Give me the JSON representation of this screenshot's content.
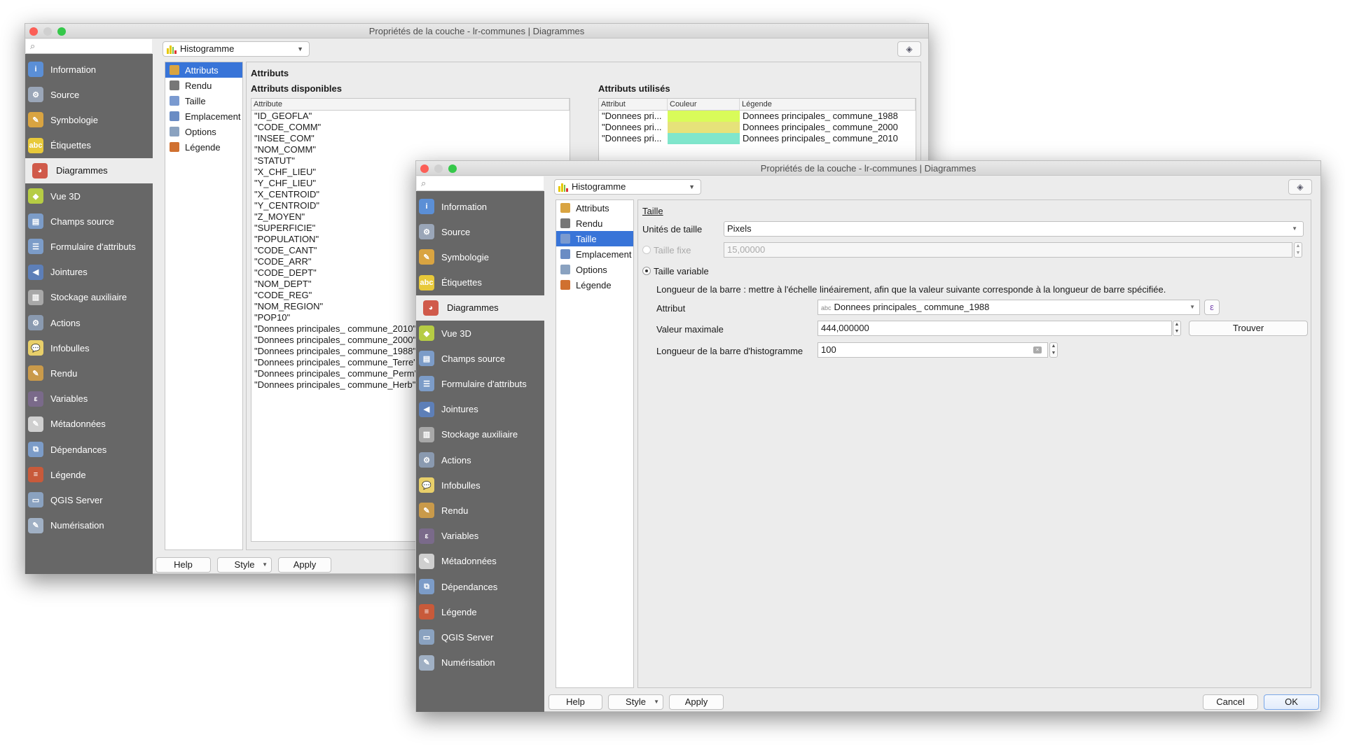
{
  "sidebar_items": [
    {
      "label": "Information",
      "icon": "information-icon",
      "color": "#5b8fd6",
      "glyph": "i"
    },
    {
      "label": "Source",
      "icon": "source-gear-icon",
      "color": "#9aa6b8",
      "glyph": "⚙"
    },
    {
      "label": "Symbologie",
      "icon": "symbology-brush-icon",
      "color": "#d9a441",
      "glyph": "✎"
    },
    {
      "label": "Étiquettes",
      "icon": "labels-abc-icon",
      "color": "#e8c93a",
      "glyph": "abc"
    },
    {
      "label": "Diagrammes",
      "icon": "diagrams-icon",
      "color": "#d05a4a",
      "glyph": "◕"
    },
    {
      "label": "Vue 3D",
      "icon": "3d-cube-icon",
      "color": "#b6cc44",
      "glyph": "◆"
    },
    {
      "label": "Champs source",
      "icon": "source-fields-icon",
      "color": "#7c9cc8",
      "glyph": "▤"
    },
    {
      "label": "Formulaire d'attributs",
      "icon": "attribute-form-icon",
      "color": "#7c9cc8",
      "glyph": "☰"
    },
    {
      "label": "Jointures",
      "icon": "joins-icon",
      "color": "#5d7fb8",
      "glyph": "◀"
    },
    {
      "label": "Stockage auxiliaire",
      "icon": "auxiliary-storage-icon",
      "color": "#a8a8a8",
      "glyph": "▥"
    },
    {
      "label": "Actions",
      "icon": "actions-gear-icon",
      "color": "#8a9ab0",
      "glyph": "⚙"
    },
    {
      "label": "Infobulles",
      "icon": "tooltip-bubble-icon",
      "color": "#e8cf6a",
      "glyph": "💬"
    },
    {
      "label": "Rendu",
      "icon": "rendering-brush-icon",
      "color": "#c99a4a",
      "glyph": "✎"
    },
    {
      "label": "Variables",
      "icon": "variables-icon",
      "color": "#7a6a8a",
      "glyph": "ε"
    },
    {
      "label": "Métadonnées",
      "icon": "metadata-icon",
      "color": "#cfcfcf",
      "glyph": "✎"
    },
    {
      "label": "Dépendances",
      "icon": "dependencies-icon",
      "color": "#7c9cc8",
      "glyph": "⧉"
    },
    {
      "label": "Légende",
      "icon": "legend-icon",
      "color": "#c85a3a",
      "glyph": "≡"
    },
    {
      "label": "QGIS Server",
      "icon": "qgis-server-icon",
      "color": "#8aa2c0",
      "glyph": "▭"
    },
    {
      "label": "Numérisation",
      "icon": "digitizing-icon",
      "color": "#a0b0c4",
      "glyph": "✎"
    }
  ],
  "selected_sidebar": "Diagrammes",
  "subtabs": [
    {
      "label": "Attributs",
      "icon": "attributes-brush-icon",
      "color": "#d9a441"
    },
    {
      "label": "Rendu",
      "icon": "rendering-pen-icon",
      "color": "#777"
    },
    {
      "label": "Taille",
      "icon": "size-icon",
      "color": "#7a9ad0"
    },
    {
      "label": "Emplacement",
      "icon": "placement-icon",
      "color": "#6a8cc4"
    },
    {
      "label": "Options",
      "icon": "options-gear-icon",
      "color": "#8aa2c0"
    },
    {
      "label": "Légende",
      "icon": "legend-icon",
      "color": "#d07030"
    }
  ],
  "back_window": {
    "title": "Propriétés de la couche - lr-communes | Diagrammes",
    "diagram_type": "Histogramme",
    "selected_subtab": "Attributs",
    "section_title": "Attributs",
    "available_title": "Attributs disponibles",
    "available_header": "Attribute",
    "available": [
      "\"ID_GEOFLA\"",
      "\"CODE_COMM\"",
      "\"INSEE_COM\"",
      "\"NOM_COMM\"",
      "\"STATUT\"",
      "\"X_CHF_LIEU\"",
      "\"Y_CHF_LIEU\"",
      "\"X_CENTROID\"",
      "\"Y_CENTROID\"",
      "\"Z_MOYEN\"",
      "\"SUPERFICIE\"",
      "\"POPULATION\"",
      "\"CODE_CANT\"",
      "\"CODE_ARR\"",
      "\"CODE_DEPT\"",
      "\"NOM_DEPT\"",
      "\"CODE_REG\"",
      "\"NOM_REGION\"",
      "\"POP10\"",
      "\"Donnees principales_ commune_2010\"",
      "\"Donnees principales_ commune_2000\"",
      "\"Donnees principales_ commune_1988\"",
      "\"Donnees principales_ commune_Terre\"",
      "\"Donnees principales_ commune_Perm\"",
      "\"Donnees principales_ commune_Herb\""
    ],
    "used_title": "Attributs utilisés",
    "used_headers": [
      "Attribut",
      "Couleur",
      "Légende"
    ],
    "used": [
      {
        "attribut": "\"Donnees pri...",
        "color": "#d9fb5a",
        "legend": "Donnees principales_ commune_1988"
      },
      {
        "attribut": "\"Donnees pri...",
        "color": "#e6e27a",
        "legend": "Donnees principales_ commune_2000"
      },
      {
        "attribut": "\"Donnees pri...",
        "color": "#80e6cc",
        "legend": "Donnees principales_ commune_2010"
      }
    ],
    "buttons": {
      "help": "Help",
      "style": "Style",
      "apply": "Apply"
    }
  },
  "front_window": {
    "title": "Propriétés de la couche - lr-communes | Diagrammes",
    "diagram_type": "Histogramme",
    "selected_subtab": "Taille",
    "section_title": "Taille",
    "units_label": "Unités de taille",
    "units_value": "Pixels",
    "fixed_label": "Taille fixe",
    "fixed_value": "15,00000",
    "fixed_selected": false,
    "variable_label": "Taille variable",
    "variable_selected": true,
    "description": "Longueur de la barre : mettre à l'échelle linéairement, afin que la valeur suivante corresponde à la longueur de barre spécifiée.",
    "attribute_label": "Attribut",
    "attribute_type": "abc",
    "attribute_value": "Donnees principales_ commune_1988",
    "expression_symbol": "ε",
    "max_label": "Valeur maximale",
    "max_value": "444,000000",
    "find_label": "Trouver",
    "bar_length_label": "Longueur de la barre d'histogramme",
    "bar_length_value": "100",
    "buttons": {
      "help": "Help",
      "style": "Style",
      "apply": "Apply",
      "cancel": "Cancel",
      "ok": "OK"
    }
  }
}
